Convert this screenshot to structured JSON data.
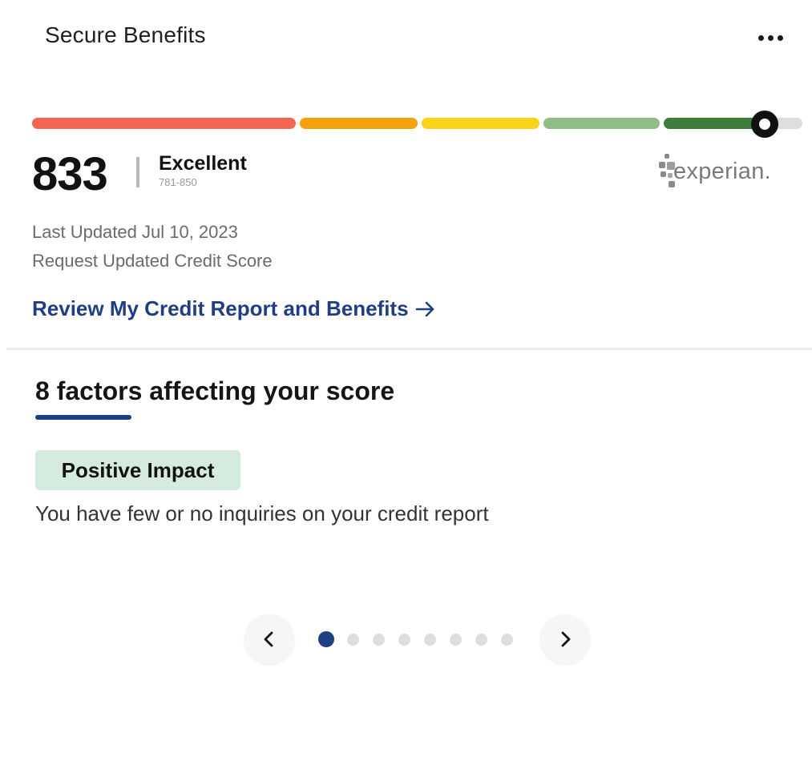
{
  "header": {
    "title": "Secure Benefits",
    "more_icon": "more-horizontal-icon"
  },
  "score": {
    "value": "833",
    "rating": "Excellent",
    "range": "781-850",
    "bureau": "experian.",
    "bar_colors": [
      "#f4664f",
      "#f5a20f",
      "#f9d317",
      "#8fbd85",
      "#3f7c3c",
      "#dddddd"
    ],
    "marker_icon": "score-marker-icon"
  },
  "meta": {
    "last_updated": "Last Updated Jul 10, 2023",
    "request_update": "Request Updated Credit Score"
  },
  "review_link": {
    "label": "Review My Credit Report and Benefits",
    "icon": "arrow-right-icon"
  },
  "factors": {
    "title": "8 factors affecting your score",
    "current": {
      "impact": "Positive Impact",
      "description": "You have few or no inquiries on your credit report"
    },
    "pager": {
      "total": 8,
      "active_index": 0
    },
    "prev_icon": "chevron-left-icon",
    "next_icon": "chevron-right-icon"
  },
  "colors": {
    "accent": "#1f3e84",
    "positive_badge": "#d6ebe0"
  }
}
